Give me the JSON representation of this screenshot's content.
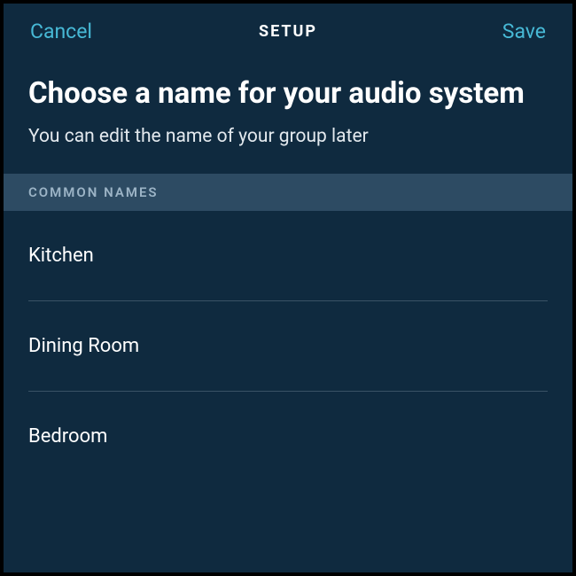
{
  "header": {
    "cancel_label": "Cancel",
    "title": "SETUP",
    "save_label": "Save"
  },
  "main": {
    "title": "Choose a name for your audio system",
    "subtitle": "You can edit the name of your group later"
  },
  "section": {
    "header": "COMMON NAMES",
    "items": [
      {
        "label": "Kitchen"
      },
      {
        "label": "Dining Room"
      },
      {
        "label": "Bedroom"
      }
    ]
  }
}
